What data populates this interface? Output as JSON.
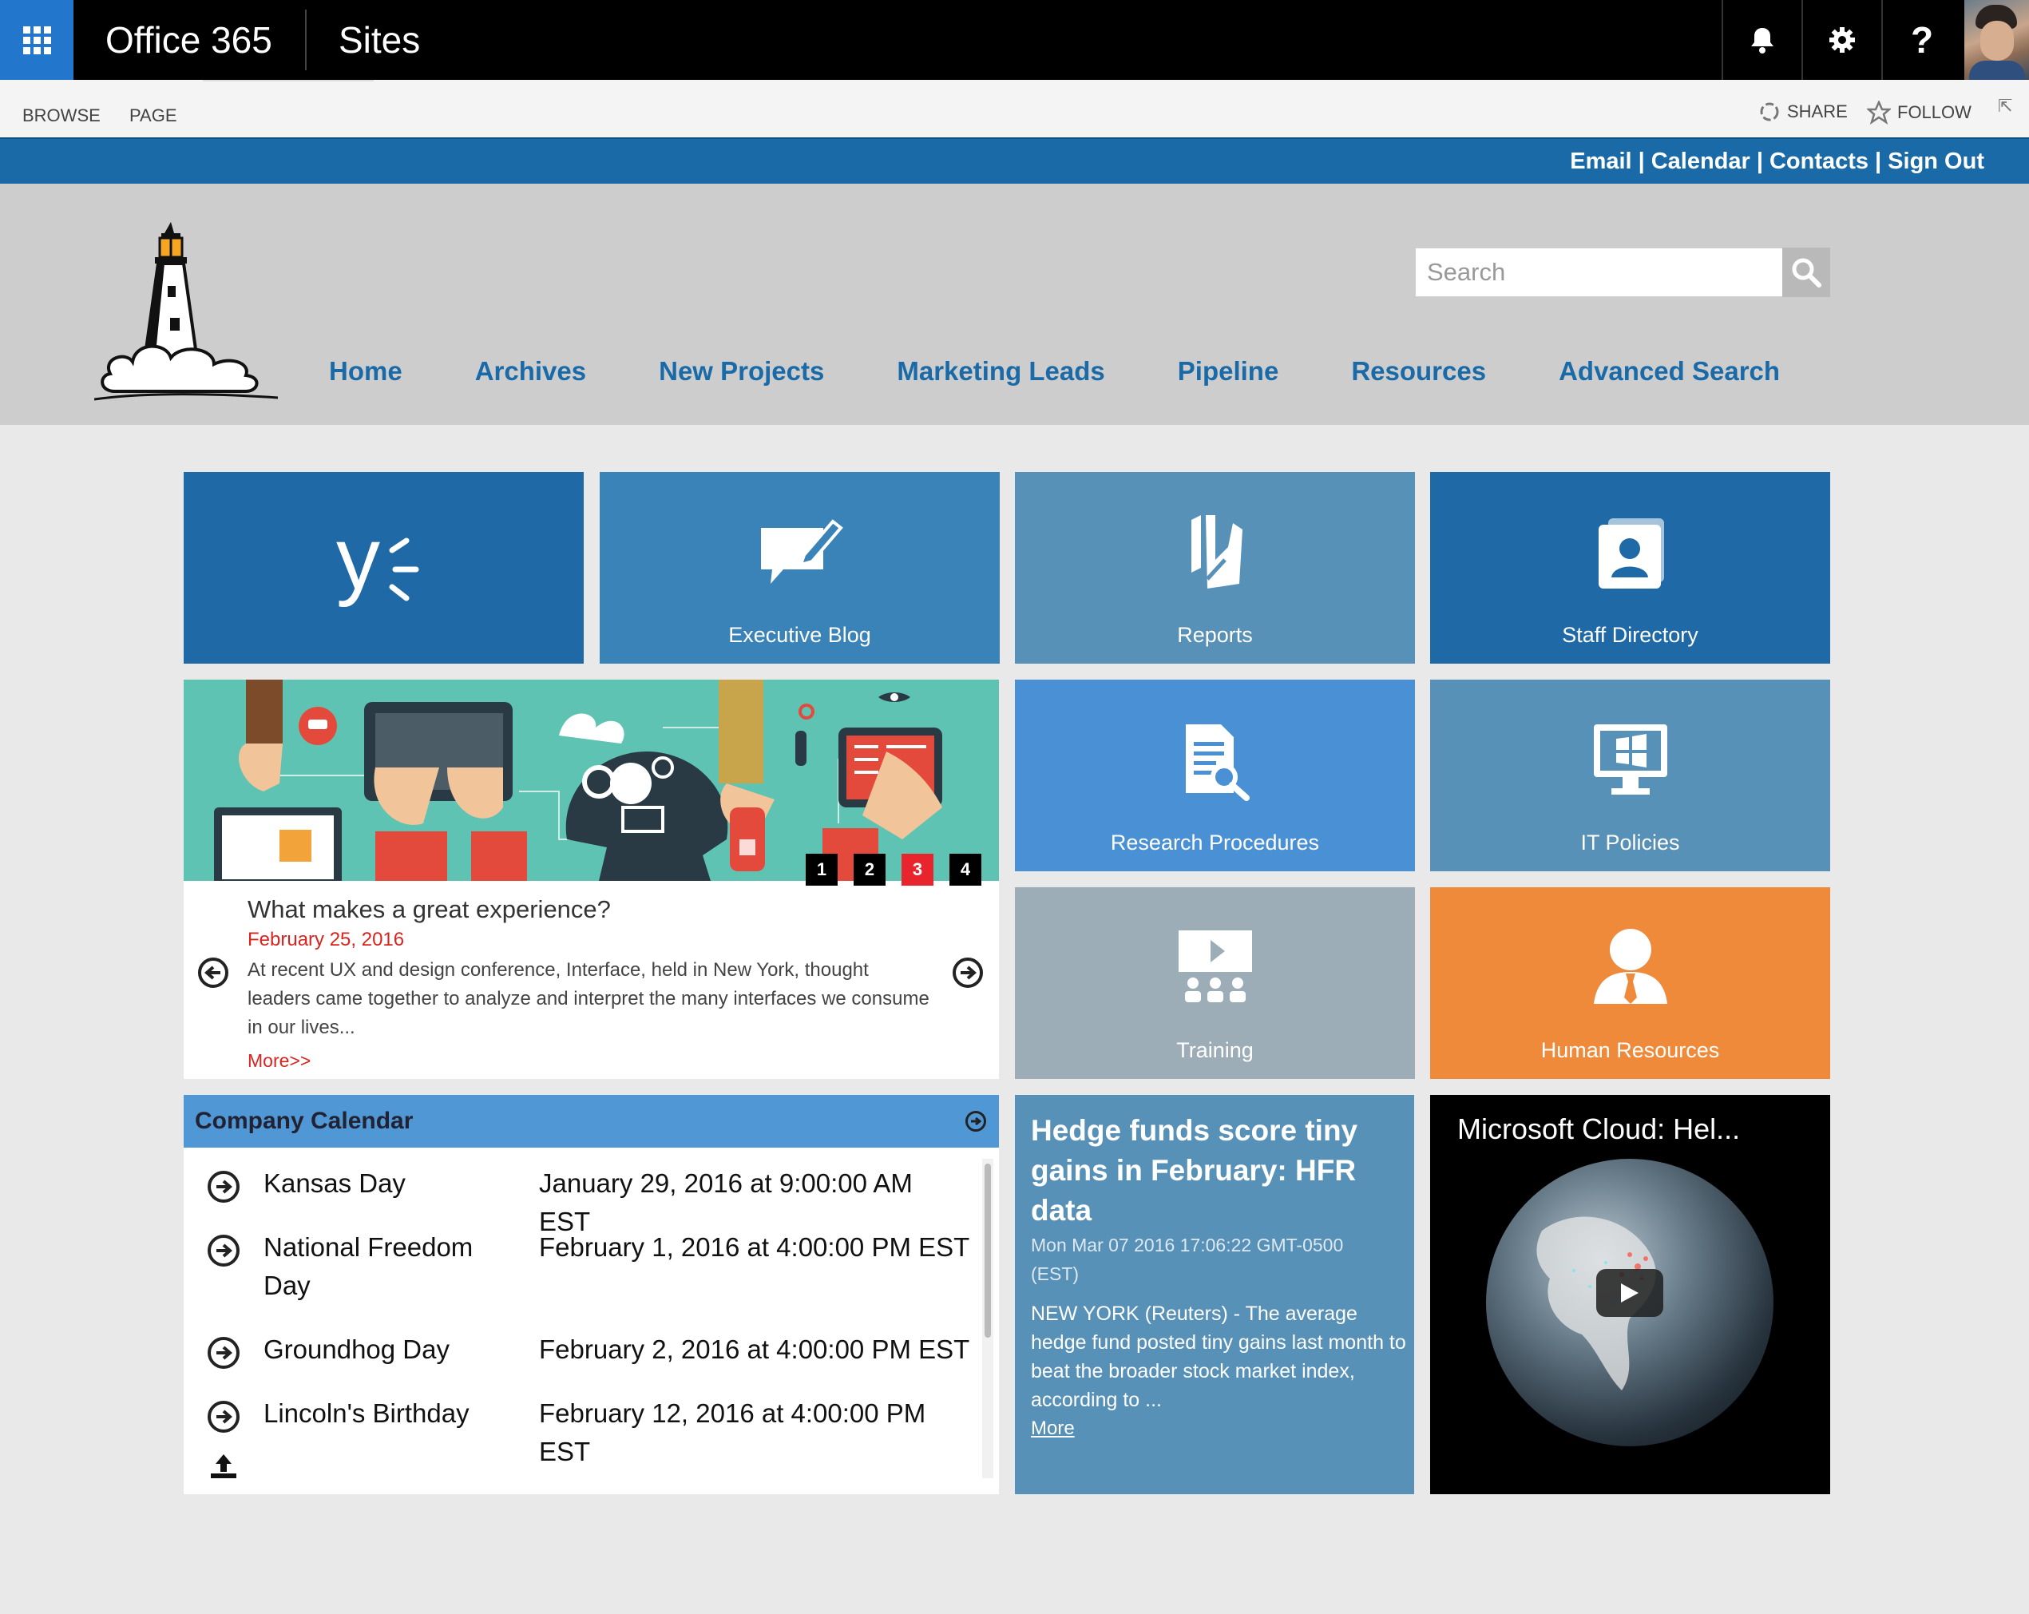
{
  "suitebar": {
    "brand": "Office 365",
    "app": "Sites",
    "help_label": "?"
  },
  "ribbon": {
    "tabs": [
      "BROWSE",
      "PAGE"
    ],
    "share_label": "SHARE",
    "follow_label": "FOLLOW"
  },
  "utility_links": [
    "Email",
    "Calendar",
    "Contacts",
    "Sign Out"
  ],
  "utility_separator": "|",
  "search": {
    "placeholder": "Search"
  },
  "nav": [
    "Home",
    "Archives",
    "New Projects",
    "Marketing Leads",
    "Pipeline",
    "Resources",
    "Advanced Search"
  ],
  "tiles": {
    "yammer": {
      "label": "",
      "color": "#1f6aa6",
      "icon": "yammer-icon"
    },
    "executive_blog": {
      "label": "Executive Blog",
      "color": "#3a83b8",
      "icon": "blog-edit-icon"
    },
    "reports": {
      "label": "Reports",
      "color": "#5891b8",
      "icon": "reports-icon"
    },
    "staff_directory": {
      "label": "Staff Directory",
      "color": "#1f6aa6",
      "icon": "contact-card-icon"
    },
    "research_procedures": {
      "label": "Research Procedures",
      "color": "#4a90d5",
      "icon": "document-search-icon"
    },
    "it_policies": {
      "label": "IT Policies",
      "color": "#5891b8",
      "icon": "windows-monitor-icon"
    },
    "training": {
      "label": "Training",
      "color": "#9dadb8",
      "icon": "presentation-icon"
    },
    "human_resources": {
      "label": "Human Resources",
      "color": "#ef8a3a",
      "icon": "person-tie-icon"
    }
  },
  "feature": {
    "slides": [
      "1",
      "2",
      "3",
      "4"
    ],
    "active_slide": "3",
    "title": "What makes a great experience?",
    "date": "February 25, 2016",
    "body": "At recent UX and design conference, Interface, held in New York, thought leaders came together to analyze and interpret the many interfaces we consume in our lives...",
    "more": "More>>"
  },
  "calendar": {
    "title": "Company Calendar",
    "events": [
      {
        "name": "Kansas Day",
        "when": "January 29, 2016 at 9:00:00 AM EST"
      },
      {
        "name": "National Freedom Day",
        "when": "February 1, 2016 at 4:00:00 PM EST"
      },
      {
        "name": "Groundhog Day",
        "when": "February 2, 2016 at 4:00:00 PM EST"
      },
      {
        "name": "Lincoln's Birthday",
        "when": "February 12, 2016 at 4:00:00 PM EST"
      }
    ]
  },
  "news": {
    "title": "Hedge funds score tiny gains in February: HFR data",
    "date": "Mon Mar 07 2016 17:06:22 GMT-0500 (EST)",
    "body": "NEW YORK (Reuters) - The average hedge fund posted tiny gains last month to beat the broader stock market index, according to ...",
    "more": "More"
  },
  "video": {
    "title": "Microsoft Cloud: Hel..."
  },
  "colors": {
    "suite_bar": "#000000",
    "app_launcher": "#2277cc",
    "utility_bar": "#1a6aa8",
    "nav_link": "#1a6aa8",
    "header_bg": "#cdcdcd",
    "calendar_header": "#5097d6",
    "active_dot": "#e8252c",
    "date_red": "#d9241e"
  }
}
